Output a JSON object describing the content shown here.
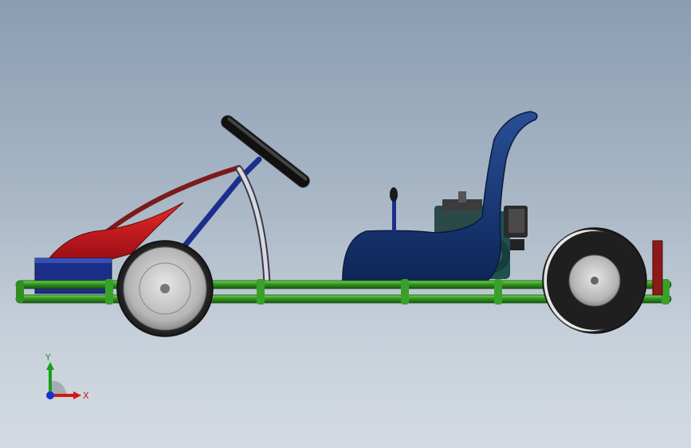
{
  "viewport": {
    "background_top": "#8a9db3",
    "background_bottom": "#d3dae1"
  },
  "model": {
    "parts": [
      "steering-wheel",
      "steering-column",
      "seat",
      "engine",
      "front-wheel",
      "rear-wheel",
      "chassis-frame",
      "front-bumper",
      "nose-fairing",
      "gear-lever",
      "rear-upright"
    ],
    "colors": {
      "frame": "#2f8f1f",
      "frame_highlight": "#5fcf3f",
      "seat": "#14336e",
      "fairing_red": "#c8141e",
      "bar_red": "#8c1a1a",
      "column_blue": "#1c2d8c",
      "tire": "#3a3a3a",
      "rim": "#c8c8c8"
    }
  },
  "triad": {
    "x_label": "X",
    "y_label": "Y",
    "x_color": "#d01818",
    "y_color": "#18a018",
    "z_color": "#1830d0"
  }
}
